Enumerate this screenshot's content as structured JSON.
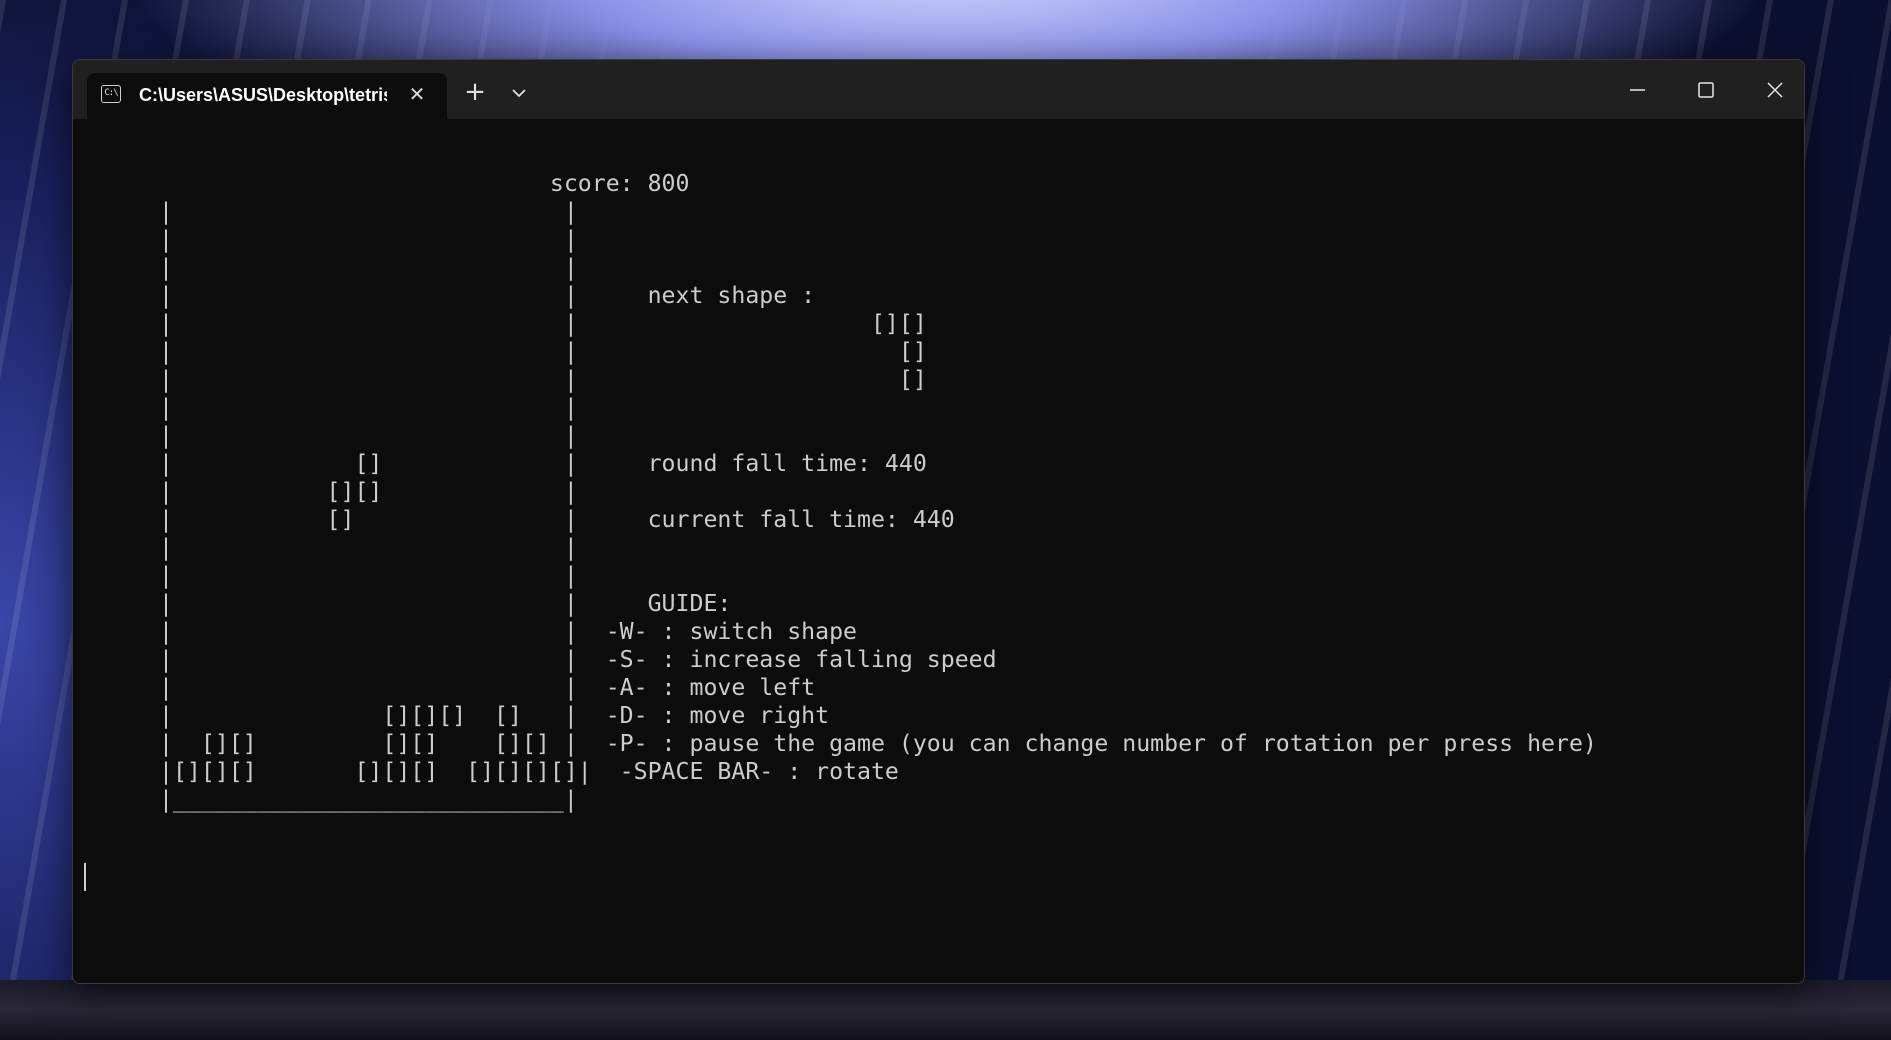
{
  "window": {
    "tab_title": "C:\\Users\\ASUS\\Desktop\\tetris",
    "tab_icon": "C:\\",
    "new_tab_label": "+",
    "close_tab_label": "✕"
  },
  "terminal": {
    "lines": [
      "                            score: 800",
      "|                            |",
      "|                            |",
      "|                            |",
      "|                            |     next shape :",
      "|                            |                     [][]",
      "|                            |                       []",
      "|                            |                       []",
      "|                            |",
      "|                            |",
      "|             []             |     round fall time: 440",
      "|           [][]             |",
      "|           []               |     current fall time: 440",
      "|                            |",
      "|                            |",
      "|                            |     GUIDE:",
      "|                            |  -W- : switch shape",
      "|                            |  -S- : increase falling speed",
      "|                            |  -A- : move left",
      "|               [][][]  []   |  -D- : move right",
      "|  [][]         [][]    [][] |  -P- : pause the game (you can change number of rotation per press here)",
      "|[][][]       [][][]  [][][][]|  -SPACE BAR- : rotate",
      "|____________________________|"
    ]
  },
  "colors": {
    "terminal_bg": "#0c0c0c",
    "terminal_fg": "#cccccc",
    "titlebar_bg": "#202020"
  }
}
